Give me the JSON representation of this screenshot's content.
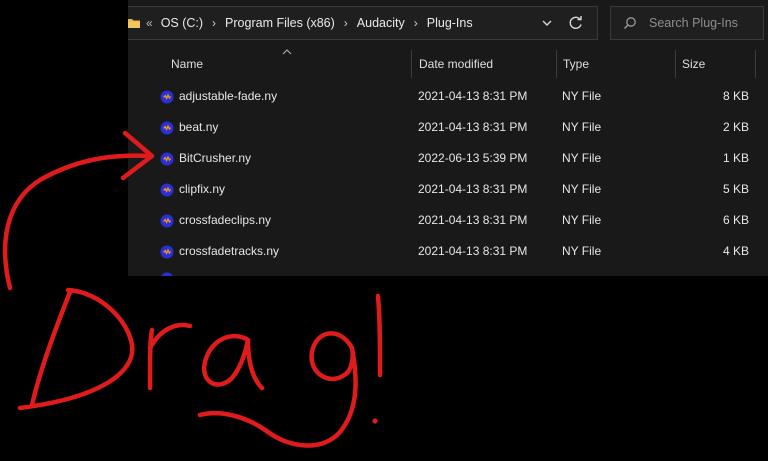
{
  "breadcrumb": {
    "overflow": "«",
    "items": [
      "OS (C:)",
      "Program Files (x86)",
      "Audacity",
      "Plug-Ins"
    ],
    "separator": "›"
  },
  "search": {
    "placeholder": "Search Plug-Ins"
  },
  "columns": {
    "name": "Name",
    "date": "Date modified",
    "type": "Type",
    "size": "Size"
  },
  "files": [
    {
      "name": "adjustable-fade.ny",
      "date": "2021-04-13 8:31 PM",
      "type": "NY File",
      "size": "8 KB"
    },
    {
      "name": "beat.ny",
      "date": "2021-04-13 8:31 PM",
      "type": "NY File",
      "size": "2 KB"
    },
    {
      "name": "BitCrusher.ny",
      "date": "2022-06-13 5:39 PM",
      "type": "NY File",
      "size": "1 KB"
    },
    {
      "name": "clipfix.ny",
      "date": "2021-04-13 8:31 PM",
      "type": "NY File",
      "size": "5 KB"
    },
    {
      "name": "crossfadeclips.ny",
      "date": "2021-04-13 8:31 PM",
      "type": "NY File",
      "size": "6 KB"
    },
    {
      "name": "crossfadetracks.ny",
      "date": "2021-04-13 8:31 PM",
      "type": "NY File",
      "size": "4 KB"
    }
  ],
  "annotation": {
    "text": "Drag!",
    "color": "#e01b1b"
  },
  "icons": {
    "folder": "folder-icon",
    "file": "audacity-file-icon",
    "search": "search-icon",
    "refresh": "refresh-icon",
    "dropdown": "chevron-down-icon",
    "sort": "sort-ascending-icon"
  }
}
